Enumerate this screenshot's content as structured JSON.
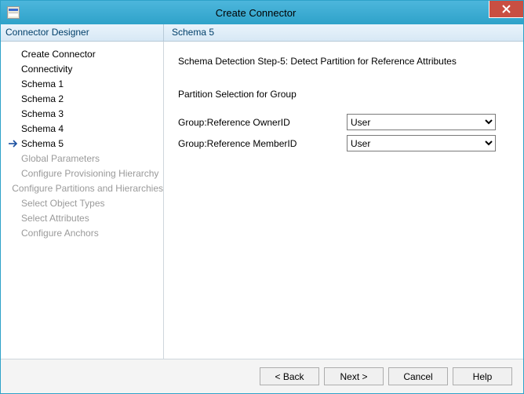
{
  "window": {
    "title": "Create Connector"
  },
  "header": {
    "left": "Connector Designer",
    "right": "Schema 5"
  },
  "sidebar": {
    "items": [
      {
        "label": "Create Connector",
        "disabled": false,
        "current": false
      },
      {
        "label": "Connectivity",
        "disabled": false,
        "current": false
      },
      {
        "label": "Schema 1",
        "disabled": false,
        "current": false
      },
      {
        "label": "Schema 2",
        "disabled": false,
        "current": false
      },
      {
        "label": "Schema 3",
        "disabled": false,
        "current": false
      },
      {
        "label": "Schema 4",
        "disabled": false,
        "current": false
      },
      {
        "label": "Schema 5",
        "disabled": false,
        "current": true
      },
      {
        "label": "Global Parameters",
        "disabled": true,
        "current": false
      },
      {
        "label": "Configure Provisioning Hierarchy",
        "disabled": true,
        "current": false
      },
      {
        "label": "Configure Partitions and Hierarchies",
        "disabled": true,
        "current": false
      },
      {
        "label": "Select Object Types",
        "disabled": true,
        "current": false
      },
      {
        "label": "Select Attributes",
        "disabled": true,
        "current": false
      },
      {
        "label": "Configure Anchors",
        "disabled": true,
        "current": false
      }
    ]
  },
  "content": {
    "step_title": "Schema Detection Step-5: Detect Partition for Reference Attributes",
    "section_title": "Partition Selection for Group",
    "rows": [
      {
        "label": "Group:Reference OwnerID",
        "value": "User"
      },
      {
        "label": "Group:Reference MemberID",
        "value": "User"
      }
    ]
  },
  "footer": {
    "back": "<  Back",
    "next": "Next  >",
    "cancel": "Cancel",
    "help": "Help"
  }
}
